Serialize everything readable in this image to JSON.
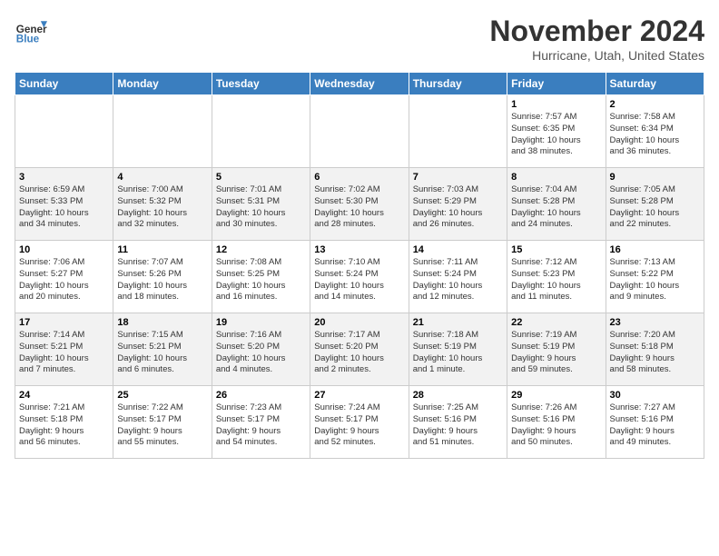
{
  "header": {
    "logo_line1": "General",
    "logo_line2": "Blue",
    "month": "November 2024",
    "location": "Hurricane, Utah, United States"
  },
  "weekdays": [
    "Sunday",
    "Monday",
    "Tuesday",
    "Wednesday",
    "Thursday",
    "Friday",
    "Saturday"
  ],
  "weeks": [
    [
      {
        "day": "",
        "info": ""
      },
      {
        "day": "",
        "info": ""
      },
      {
        "day": "",
        "info": ""
      },
      {
        "day": "",
        "info": ""
      },
      {
        "day": "",
        "info": ""
      },
      {
        "day": "1",
        "info": "Sunrise: 7:57 AM\nSunset: 6:35 PM\nDaylight: 10 hours\nand 38 minutes."
      },
      {
        "day": "2",
        "info": "Sunrise: 7:58 AM\nSunset: 6:34 PM\nDaylight: 10 hours\nand 36 minutes."
      }
    ],
    [
      {
        "day": "3",
        "info": "Sunrise: 6:59 AM\nSunset: 5:33 PM\nDaylight: 10 hours\nand 34 minutes."
      },
      {
        "day": "4",
        "info": "Sunrise: 7:00 AM\nSunset: 5:32 PM\nDaylight: 10 hours\nand 32 minutes."
      },
      {
        "day": "5",
        "info": "Sunrise: 7:01 AM\nSunset: 5:31 PM\nDaylight: 10 hours\nand 30 minutes."
      },
      {
        "day": "6",
        "info": "Sunrise: 7:02 AM\nSunset: 5:30 PM\nDaylight: 10 hours\nand 28 minutes."
      },
      {
        "day": "7",
        "info": "Sunrise: 7:03 AM\nSunset: 5:29 PM\nDaylight: 10 hours\nand 26 minutes."
      },
      {
        "day": "8",
        "info": "Sunrise: 7:04 AM\nSunset: 5:28 PM\nDaylight: 10 hours\nand 24 minutes."
      },
      {
        "day": "9",
        "info": "Sunrise: 7:05 AM\nSunset: 5:28 PM\nDaylight: 10 hours\nand 22 minutes."
      }
    ],
    [
      {
        "day": "10",
        "info": "Sunrise: 7:06 AM\nSunset: 5:27 PM\nDaylight: 10 hours\nand 20 minutes."
      },
      {
        "day": "11",
        "info": "Sunrise: 7:07 AM\nSunset: 5:26 PM\nDaylight: 10 hours\nand 18 minutes."
      },
      {
        "day": "12",
        "info": "Sunrise: 7:08 AM\nSunset: 5:25 PM\nDaylight: 10 hours\nand 16 minutes."
      },
      {
        "day": "13",
        "info": "Sunrise: 7:10 AM\nSunset: 5:24 PM\nDaylight: 10 hours\nand 14 minutes."
      },
      {
        "day": "14",
        "info": "Sunrise: 7:11 AM\nSunset: 5:24 PM\nDaylight: 10 hours\nand 12 minutes."
      },
      {
        "day": "15",
        "info": "Sunrise: 7:12 AM\nSunset: 5:23 PM\nDaylight: 10 hours\nand 11 minutes."
      },
      {
        "day": "16",
        "info": "Sunrise: 7:13 AM\nSunset: 5:22 PM\nDaylight: 10 hours\nand 9 minutes."
      }
    ],
    [
      {
        "day": "17",
        "info": "Sunrise: 7:14 AM\nSunset: 5:21 PM\nDaylight: 10 hours\nand 7 minutes."
      },
      {
        "day": "18",
        "info": "Sunrise: 7:15 AM\nSunset: 5:21 PM\nDaylight: 10 hours\nand 6 minutes."
      },
      {
        "day": "19",
        "info": "Sunrise: 7:16 AM\nSunset: 5:20 PM\nDaylight: 10 hours\nand 4 minutes."
      },
      {
        "day": "20",
        "info": "Sunrise: 7:17 AM\nSunset: 5:20 PM\nDaylight: 10 hours\nand 2 minutes."
      },
      {
        "day": "21",
        "info": "Sunrise: 7:18 AM\nSunset: 5:19 PM\nDaylight: 10 hours\nand 1 minute."
      },
      {
        "day": "22",
        "info": "Sunrise: 7:19 AM\nSunset: 5:19 PM\nDaylight: 9 hours\nand 59 minutes."
      },
      {
        "day": "23",
        "info": "Sunrise: 7:20 AM\nSunset: 5:18 PM\nDaylight: 9 hours\nand 58 minutes."
      }
    ],
    [
      {
        "day": "24",
        "info": "Sunrise: 7:21 AM\nSunset: 5:18 PM\nDaylight: 9 hours\nand 56 minutes."
      },
      {
        "day": "25",
        "info": "Sunrise: 7:22 AM\nSunset: 5:17 PM\nDaylight: 9 hours\nand 55 minutes."
      },
      {
        "day": "26",
        "info": "Sunrise: 7:23 AM\nSunset: 5:17 PM\nDaylight: 9 hours\nand 54 minutes."
      },
      {
        "day": "27",
        "info": "Sunrise: 7:24 AM\nSunset: 5:17 PM\nDaylight: 9 hours\nand 52 minutes."
      },
      {
        "day": "28",
        "info": "Sunrise: 7:25 AM\nSunset: 5:16 PM\nDaylight: 9 hours\nand 51 minutes."
      },
      {
        "day": "29",
        "info": "Sunrise: 7:26 AM\nSunset: 5:16 PM\nDaylight: 9 hours\nand 50 minutes."
      },
      {
        "day": "30",
        "info": "Sunrise: 7:27 AM\nSunset: 5:16 PM\nDaylight: 9 hours\nand 49 minutes."
      }
    ]
  ]
}
